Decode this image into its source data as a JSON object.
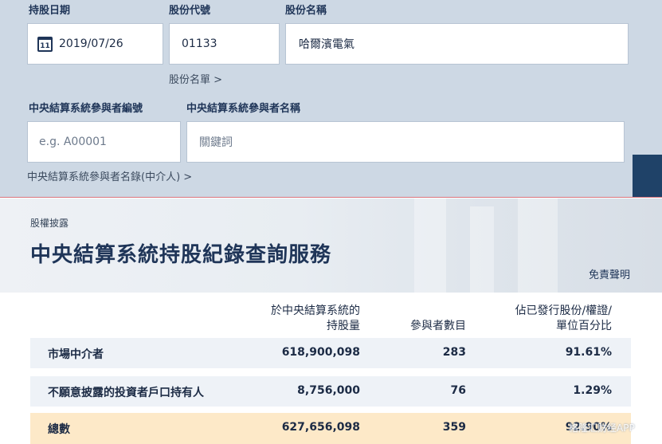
{
  "search": {
    "date_label": "持股日期",
    "code_label": "股份代號",
    "name_label": "股份名稱",
    "calendar_day": "11",
    "date_value": "2019/07/26",
    "code_value": "01133",
    "name_value": "哈爾濱電氣",
    "stock_list_link": "股份名單 >",
    "participant_id_label": "中央結算系統參與者編號",
    "participant_name_label": "中央結算系統參與者名稱",
    "participant_id_placeholder": "e.g. A00001",
    "participant_name_placeholder": "關鍵詞",
    "participant_list_link": "中央結算系統參與者名錄(中介人) >"
  },
  "hero": {
    "subtitle": "股權披露",
    "title": "中央結算系統持股紀錄查詢服務",
    "disclaimer": "免責聲明"
  },
  "table": {
    "headers": {
      "holding_line1": "於中央結算系統的",
      "holding_line2": "持股量",
      "participants": "參與者數目",
      "percent_line1": "佔已發行股份/權證/",
      "percent_line2": "單位百分比"
    },
    "rows": [
      {
        "type": "市場中介者",
        "holding": "618,900,098",
        "participants": "283",
        "percent": "91.61%"
      },
      {
        "type": "不願意披露的投資者戶口持有人",
        "holding": "8,756,000",
        "participants": "76",
        "percent": "1.29%"
      },
      {
        "type": "總數",
        "holding": "627,656,098",
        "participants": "359",
        "percent": "92.90%"
      }
    ]
  },
  "watermark": "格隆汇财经APP",
  "colors": {
    "panel_bg": "#cdd8e4",
    "title": "#1f3558",
    "row_bg": "#eef2f7",
    "total_bg": "#fde9c8",
    "accent_line": "#d9737c"
  }
}
